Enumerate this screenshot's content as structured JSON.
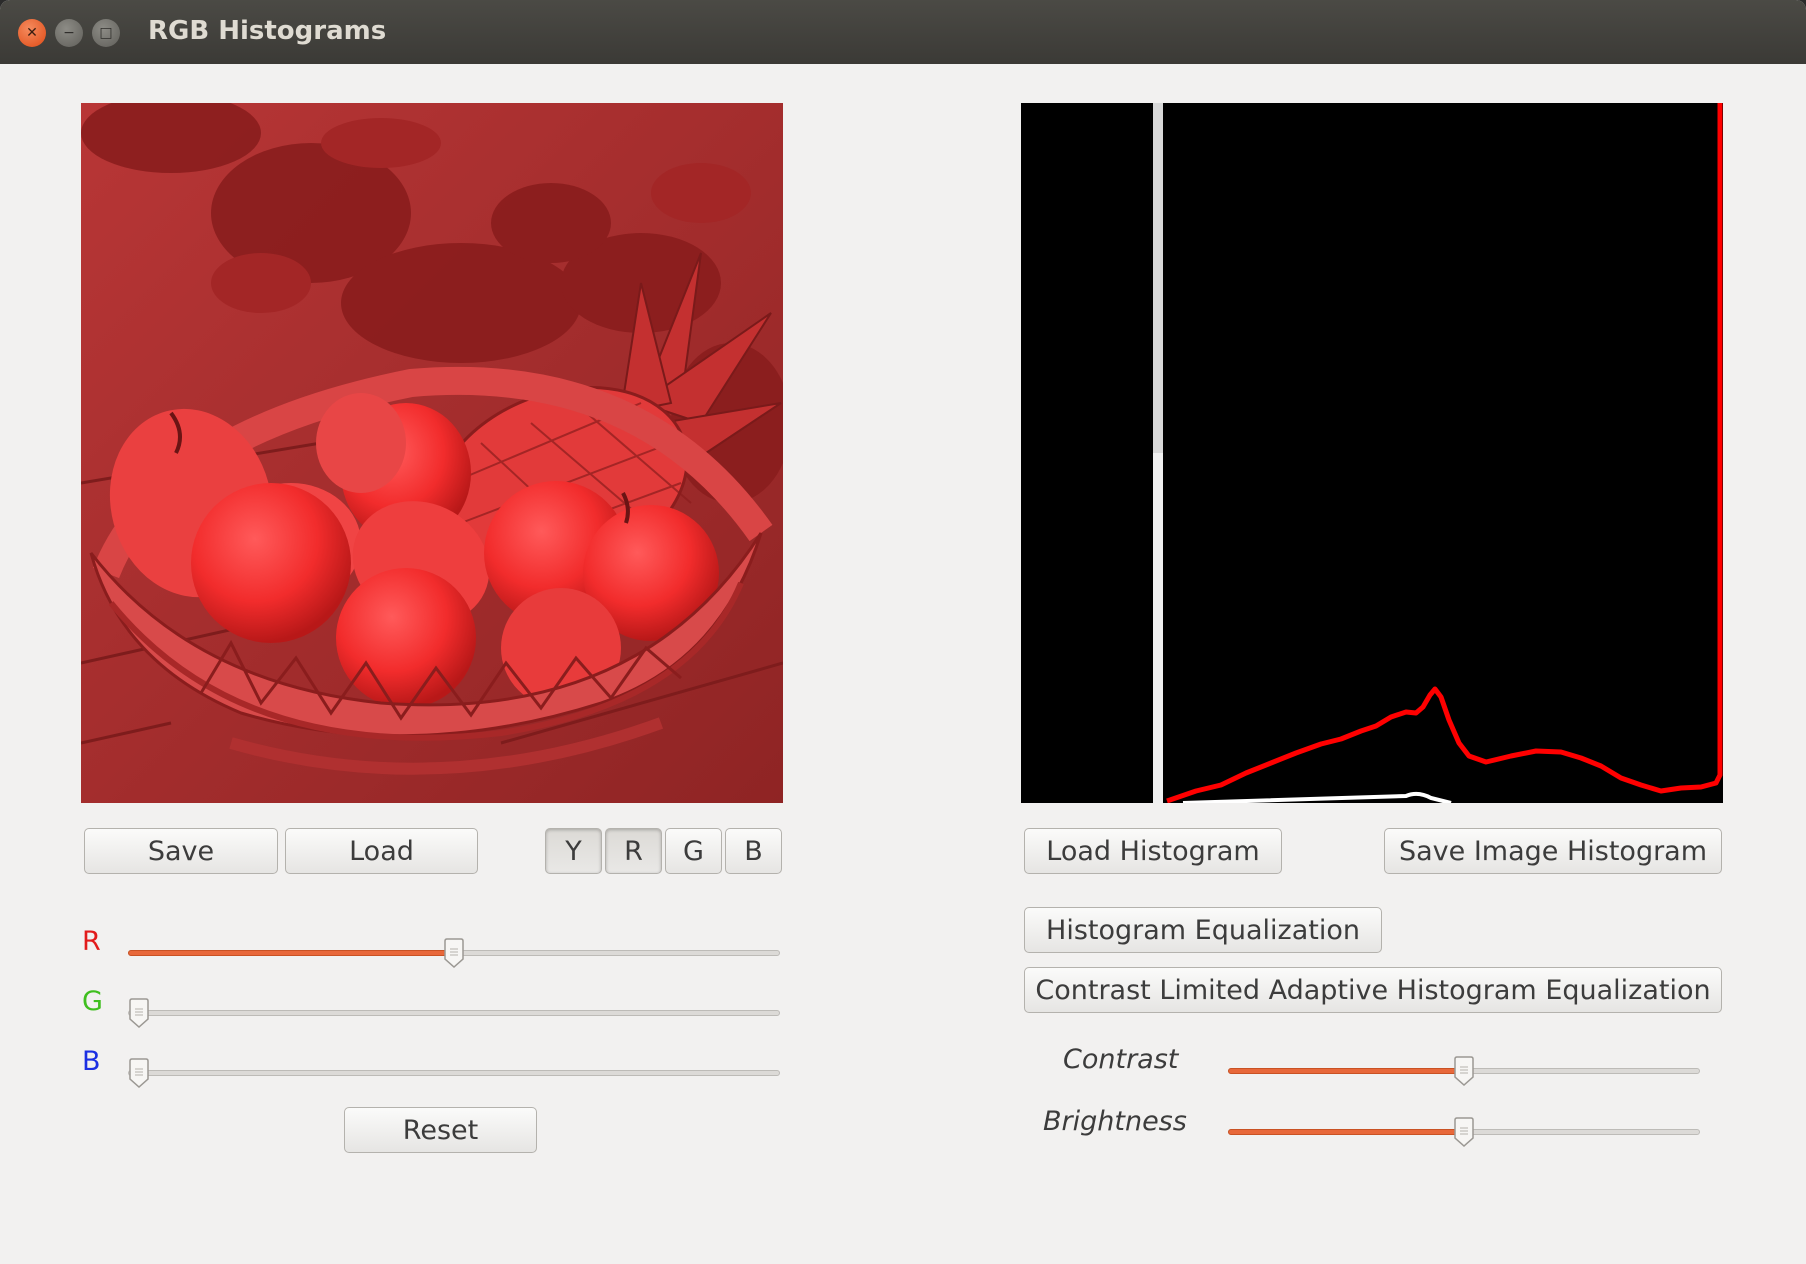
{
  "window": {
    "title": "RGB Histograms"
  },
  "toolbar_left": {
    "save_label": "Save",
    "load_label": "Load",
    "channel_buttons": [
      "Y",
      "R",
      "G",
      "B"
    ],
    "active_channels": [
      "Y",
      "R"
    ]
  },
  "color_sliders": {
    "r_label": "R",
    "g_label": "G",
    "b_label": "B",
    "r_level": 0.5,
    "g_level": 0.0,
    "b_level": 0.0,
    "r_color": "#e21b1b",
    "g_color": "#3fbf1f",
    "b_color": "#1b2fe2",
    "reset_label": "Reset"
  },
  "right_panel": {
    "load_histogram_label": "Load Histogram",
    "save_histogram_label": "Save Image Histogram",
    "equalization_label": "Histogram Equalization",
    "clahe_label": "Contrast Limited Adaptive Histogram Equalization",
    "contrast_label": "Contrast",
    "brightness_label": "Brightness",
    "contrast_level": 0.5,
    "brightness_level": 0.5
  },
  "colors": {
    "accent": "#e8683a",
    "image_tint": "#d42a2a",
    "histogram_line": "#ff0000"
  }
}
